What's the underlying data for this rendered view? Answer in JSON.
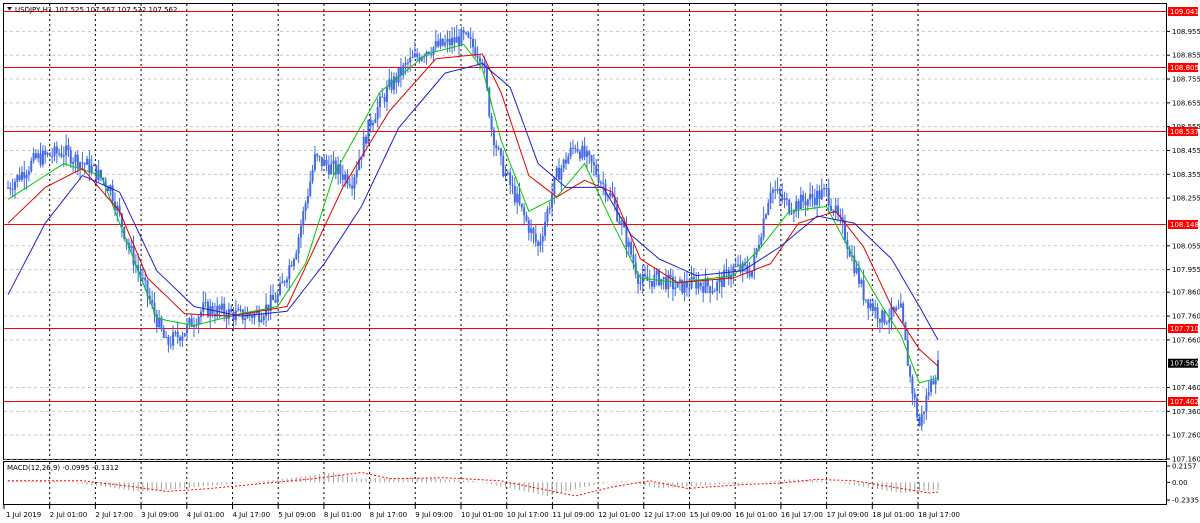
{
  "header": {
    "title": "USDJPY,H1",
    "ohlc": "107.525 107.567 107.522 107.562"
  },
  "colors": {
    "candle": "#4169e1",
    "ma_fast": "#00c800",
    "ma_mid": "#e00000",
    "ma_slow": "#1e1ecc",
    "hline": "#ff0000",
    "macd": "#ff0000",
    "hist": "#a0a0a0"
  },
  "chart_data": {
    "type": "candlestick",
    "symbol": "USDJPY",
    "timeframe": "H1",
    "ylim": [
      107.16,
      109.07
    ],
    "y_ticks": [
      "108.955",
      "108.855",
      "108.755",
      "108.655",
      "108.555",
      "108.455",
      "108.355",
      "108.255",
      "108.055",
      "107.955",
      "107.860",
      "107.760",
      "107.660",
      "107.460",
      "107.360",
      "107.260",
      "107.160"
    ],
    "x_ticks": [
      "1 Jul 2019",
      "2 Jul 01:00",
      "2 Jul 17:00",
      "3 Jul 09:00",
      "4 Jul 01:00",
      "4 Jul 17:00",
      "5 Jul 09:00",
      "8 Jul 01:00",
      "8 Jul 17:00",
      "9 Jul 09:00",
      "10 Jul 01:00",
      "10 Jul 17:00",
      "11 Jul 09:00",
      "12 Jul 01:00",
      "12 Jul 17:00",
      "15 Jul 09:00",
      "16 Jul 01:00",
      "16 Jul 17:00",
      "17 Jul 09:00",
      "18 Jul 01:00",
      "18 Jul 17:00"
    ],
    "horizontal_lines": [
      "109.041",
      "108.805",
      "108.537",
      "108.148",
      "107.710",
      "107.402"
    ],
    "current_price": "107.562",
    "close_anchors": [
      [
        0,
        108.3
      ],
      [
        3,
        108.42
      ],
      [
        6,
        108.45
      ],
      [
        9,
        108.38
      ],
      [
        11,
        108.3
      ],
      [
        13,
        108.05
      ],
      [
        15,
        107.85
      ],
      [
        17,
        107.64
      ],
      [
        19,
        107.7
      ],
      [
        21,
        107.79
      ],
      [
        23,
        107.78
      ],
      [
        25,
        107.76
      ],
      [
        27,
        107.77
      ],
      [
        29,
        107.84
      ],
      [
        31,
        108.05
      ],
      [
        33,
        108.42
      ],
      [
        35,
        108.38
      ],
      [
        37,
        108.33
      ],
      [
        39,
        108.58
      ],
      [
        41,
        108.72
      ],
      [
        43,
        108.82
      ],
      [
        45,
        108.88
      ],
      [
        47,
        108.9
      ],
      [
        49,
        108.93
      ],
      [
        51,
        108.85
      ],
      [
        52,
        108.55
      ],
      [
        53,
        108.4
      ],
      [
        55,
        108.22
      ],
      [
        57,
        108.05
      ],
      [
        59,
        108.35
      ],
      [
        61,
        108.48
      ],
      [
        63,
        108.38
      ],
      [
        65,
        108.25
      ],
      [
        67,
        108.02
      ],
      [
        68,
        107.9
      ],
      [
        70,
        107.92
      ],
      [
        72,
        107.88
      ],
      [
        74,
        107.9
      ],
      [
        76,
        107.88
      ],
      [
        78,
        107.96
      ],
      [
        80,
        107.95
      ],
      [
        82,
        108.3
      ],
      [
        84,
        108.22
      ],
      [
        86,
        108.25
      ],
      [
        88,
        108.28
      ],
      [
        90,
        108.1
      ],
      [
        92,
        107.85
      ],
      [
        94,
        107.75
      ],
      [
        96,
        107.78
      ],
      [
        97,
        107.5
      ],
      [
        98,
        107.3
      ],
      [
        99,
        107.45
      ],
      [
        100,
        107.55
      ]
    ],
    "ma_fast_anchors": [
      [
        0,
        108.25
      ],
      [
        6,
        108.4
      ],
      [
        10,
        108.35
      ],
      [
        13,
        108.05
      ],
      [
        16,
        107.75
      ],
      [
        20,
        107.72
      ],
      [
        25,
        107.77
      ],
      [
        29,
        107.8
      ],
      [
        32,
        107.98
      ],
      [
        35,
        108.35
      ],
      [
        40,
        108.7
      ],
      [
        45,
        108.86
      ],
      [
        49,
        108.9
      ],
      [
        51,
        108.8
      ],
      [
        53,
        108.5
      ],
      [
        56,
        108.2
      ],
      [
        59,
        108.26
      ],
      [
        62,
        108.4
      ],
      [
        65,
        108.15
      ],
      [
        68,
        107.92
      ],
      [
        72,
        107.9
      ],
      [
        78,
        107.93
      ],
      [
        81,
        108.05
      ],
      [
        84,
        108.2
      ],
      [
        88,
        108.22
      ],
      [
        91,
        108.0
      ],
      [
        94,
        107.8
      ],
      [
        96,
        107.68
      ],
      [
        98,
        107.48
      ],
      [
        100,
        107.5
      ]
    ],
    "ma_mid_anchors": [
      [
        0,
        108.15
      ],
      [
        4,
        108.3
      ],
      [
        8,
        108.38
      ],
      [
        12,
        108.2
      ],
      [
        15,
        107.92
      ],
      [
        19,
        107.77
      ],
      [
        24,
        107.76
      ],
      [
        30,
        107.8
      ],
      [
        33,
        108.05
      ],
      [
        36,
        108.3
      ],
      [
        41,
        108.62
      ],
      [
        46,
        108.84
      ],
      [
        51,
        108.86
      ],
      [
        53,
        108.7
      ],
      [
        56,
        108.35
      ],
      [
        59,
        108.26
      ],
      [
        62,
        108.33
      ],
      [
        65,
        108.28
      ],
      [
        68,
        108.0
      ],
      [
        72,
        107.9
      ],
      [
        78,
        107.92
      ],
      [
        82,
        107.98
      ],
      [
        85,
        108.15
      ],
      [
        89,
        108.2
      ],
      [
        92,
        108.05
      ],
      [
        95,
        107.8
      ],
      [
        98,
        107.62
      ],
      [
        100,
        107.55
      ]
    ],
    "ma_slow_anchors": [
      [
        0,
        107.85
      ],
      [
        4,
        108.15
      ],
      [
        8,
        108.35
      ],
      [
        12,
        108.28
      ],
      [
        16,
        107.95
      ],
      [
        20,
        107.8
      ],
      [
        25,
        107.76
      ],
      [
        30,
        107.78
      ],
      [
        34,
        107.98
      ],
      [
        38,
        108.22
      ],
      [
        42,
        108.55
      ],
      [
        47,
        108.78
      ],
      [
        51,
        108.82
      ],
      [
        54,
        108.72
      ],
      [
        57,
        108.4
      ],
      [
        60,
        108.3
      ],
      [
        64,
        108.3
      ],
      [
        67,
        108.1
      ],
      [
        70,
        108.0
      ],
      [
        74,
        107.93
      ],
      [
        79,
        107.95
      ],
      [
        83,
        108.05
      ],
      [
        87,
        108.18
      ],
      [
        91,
        108.15
      ],
      [
        95,
        108.0
      ],
      [
        98,
        107.8
      ],
      [
        100,
        107.66
      ]
    ],
    "macd": {
      "label": "MACD(12,26,9) -0.0995 -0.1312",
      "ylim": [
        -0.2335,
        0.2157
      ],
      "y_ticks": [
        "0.2157",
        "0.00",
        "-0.2335"
      ],
      "anchors": [
        [
          0,
          0.02
        ],
        [
          5,
          0.02
        ],
        [
          10,
          -0.05
        ],
        [
          14,
          -0.12
        ],
        [
          18,
          -0.09
        ],
        [
          24,
          -0.02
        ],
        [
          30,
          0.05
        ],
        [
          35,
          0.13
        ],
        [
          38,
          0.05
        ],
        [
          44,
          0.06
        ],
        [
          50,
          0.02
        ],
        [
          54,
          -0.08
        ],
        [
          58,
          -0.18
        ],
        [
          62,
          -0.06
        ],
        [
          66,
          0.02
        ],
        [
          70,
          -0.08
        ],
        [
          76,
          -0.03
        ],
        [
          80,
          -0.01
        ],
        [
          84,
          0.04
        ],
        [
          88,
          0.02
        ],
        [
          92,
          -0.06
        ],
        [
          96,
          -0.14
        ],
        [
          100,
          -0.1
        ]
      ]
    }
  }
}
